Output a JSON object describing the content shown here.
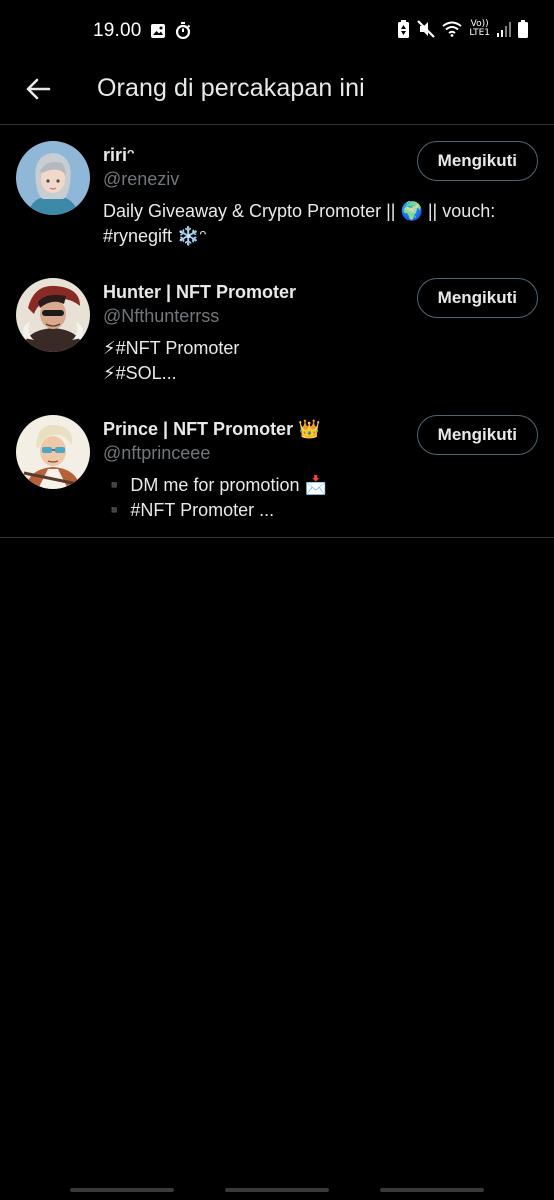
{
  "status_bar": {
    "time": "19.00",
    "network_label_top": "Vo))",
    "network_label_bottom": "LTE1"
  },
  "header": {
    "title": "Orang di percakapan ini"
  },
  "users": [
    {
      "name": "ririᵔ",
      "handle": "@reneziv",
      "bio": [
        "Daily Giveaway & Crypto Promoter || 🌍 || vouch:",
        "#rynegift ❄️ᵔ"
      ],
      "follow_label": "Mengikuti"
    },
    {
      "name": "Hunter | NFT Promoter",
      "handle": "@Nfthunterrss",
      "bio": [
        "⚡#NFT Promoter",
        "⚡#SOL..."
      ],
      "follow_label": "Mengikuti"
    },
    {
      "name": "Prince | NFT Promoter 👑",
      "handle": "@nftprinceee",
      "bio": [
        "▪️ DM me for promotion 📩",
        "▪️ #NFT Promoter ..."
      ],
      "follow_label": "Mengikuti"
    }
  ],
  "colors": {
    "background": "#000000",
    "primary_text": "#e7e9ea",
    "secondary_text": "#71767b",
    "divider": "#2f3336",
    "button_border": "#536471"
  }
}
